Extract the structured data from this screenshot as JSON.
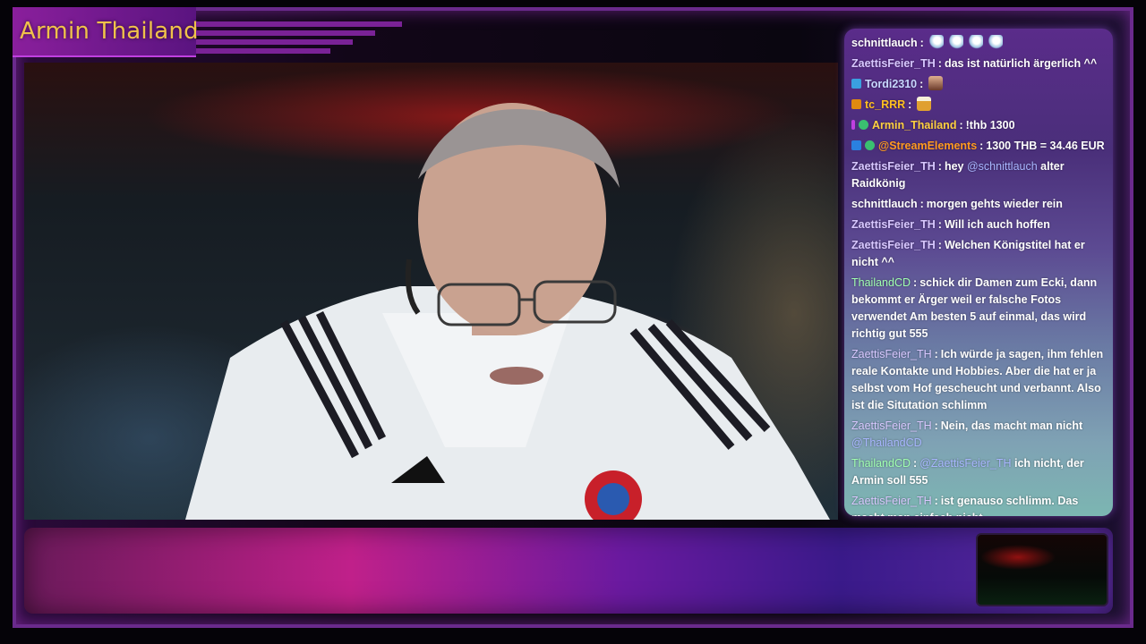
{
  "overlay": {
    "streamer_name": "Armin Thailand",
    "accent_color": "#8a1f9c",
    "name_color": "#f0c24a"
  },
  "webcam": {
    "subject": "main-webcam-feed"
  },
  "chat": {
    "messages": [
      {
        "user": "schnittlauch",
        "user_color": "#ffffff",
        "text": "",
        "emotes": [
          "bird",
          "bird",
          "bird",
          "bird"
        ]
      },
      {
        "user": "ZaettisFeier_TH",
        "user_color": "#d8c8ff",
        "text": "das ist natürlich ärgerlich ^^"
      },
      {
        "user": "Tordi2310",
        "user_color": "#c8d8ff",
        "badge": "#3aa0e0",
        "text": "",
        "emotes": [
          "face"
        ]
      },
      {
        "user": "tc_RRR",
        "user_color": "#ffc020",
        "badge": "#e08a10",
        "text": "",
        "emotes": [
          "beer"
        ]
      },
      {
        "user": "Armin_Thailand",
        "user_color": "#ffd040",
        "badge": "#c040e0",
        "badge2": "#3ac070",
        "text": "!thb 1300"
      },
      {
        "user": "@StreamElements",
        "user_color": "#ff9a20",
        "badge": "#2a80e0",
        "badge2": "#3ac070",
        "text": "1300 THB = 34.46 EUR"
      },
      {
        "user": "ZaettisFeier_TH",
        "user_color": "#d8c8ff",
        "text": "hey",
        "mention": "@schnittlauch",
        "text2": "alter Raidkönig"
      },
      {
        "user": "schnittlauch",
        "user_color": "#ffffff",
        "text": "morgen gehts wieder rein"
      },
      {
        "user": "ZaettisFeier_TH",
        "user_color": "#d8c8ff",
        "text": "Will ich auch hoffen"
      },
      {
        "user": "ZaettisFeier_TH",
        "user_color": "#d8c8ff",
        "text": "Welchen Königstitel hat er nicht ^^"
      },
      {
        "user": "ThailandCD",
        "user_color": "#a0ffb0",
        "text": "schick dir Damen zum Ecki, dann bekommt er Ärger weil er falsche Fotos verwendet Am besten 5 auf einmal, das wird richtig gut 555"
      },
      {
        "user": "ZaettisFeier_TH",
        "user_color": "#d8c8ff",
        "text": "Ich würde ja sagen, ihm fehlen reale Kontakte und Hobbies. Aber die hat er ja selbst vom Hof gescheucht und verbannt. Also ist die Situtation schlimm"
      },
      {
        "user": "ZaettisFeier_TH",
        "user_color": "#d8c8ff",
        "text": "Nein, das macht man nicht",
        "mention_after": "@ThailandCD"
      },
      {
        "user": "ThailandCD",
        "user_color": "#a0ffb0",
        "text_prefix_mention": "@ZaettisFeier_TH",
        "text": "ich nicht, der Armin soll 555"
      },
      {
        "user": "ZaettisFeier_TH",
        "user_color": "#d8c8ff",
        "text": "ist genauso schlimm. Das macht man einfach nicht"
      }
    ],
    "separator": ":"
  }
}
